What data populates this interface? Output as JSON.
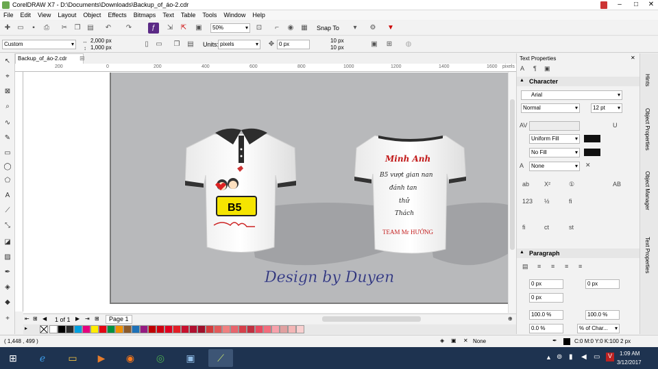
{
  "window": {
    "title": "CorelDRAW X7 - D:\\Documents\\Downloads\\Backup_of_áo-2.cdr",
    "min": "–",
    "max": "□",
    "close": "✕"
  },
  "menu": [
    "File",
    "Edit",
    "View",
    "Layout",
    "Object",
    "Effects",
    "Bitmaps",
    "Text",
    "Table",
    "Tools",
    "Window",
    "Help"
  ],
  "standard": {
    "zoom": "50%",
    "snap": "Snap To"
  },
  "property": {
    "preset": "Custom",
    "width": "2,000 px",
    "height": "1,000 px",
    "units_label": "Units:",
    "units": "pixels",
    "nudge": "0 px",
    "dup_x": "10 px",
    "dup_y": "10 px"
  },
  "document": {
    "tab": "Backup_of_áo-2.cdr",
    "ruler_ticks": [
      "200",
      "0",
      "200",
      "400",
      "600",
      "800",
      "1000",
      "1200",
      "1400",
      "1600"
    ],
    "ruler_unit": "pixels"
  },
  "design": {
    "logo_badge": "B5",
    "back_name": "Minh Anh",
    "back_line1": "B5 vượt gian nan",
    "back_line2": "đánh tan",
    "back_line3": "thử",
    "back_line4": "Thách",
    "back_team": "TEAM Mr HƯỚNG",
    "signature": "Design by Duyen"
  },
  "pager": {
    "count": "1 of 1",
    "page": "Page 1"
  },
  "palette": [
    "#ffffff",
    "#000000",
    "#2b2b2b",
    "#00a0e0",
    "#e6007e",
    "#ffed00",
    "#e30613",
    "#00923f",
    "#f39200",
    "#8b5a2b",
    "#1d71b8",
    "#951b81",
    "#c00000",
    "#d00010",
    "#e00020",
    "#e21e26",
    "#c8102e",
    "#b01030",
    "#a0102a",
    "#d43c3c",
    "#e35a5a",
    "#f08080",
    "#e8646c",
    "#d6404a",
    "#c03040",
    "#e84a5f",
    "#f26d7d",
    "#f7a1ab",
    "#e0a0a0",
    "#f4b6b6",
    "#f9d0d0"
  ],
  "docker": {
    "title": "Text Properties",
    "character": "Character",
    "font": "Arial",
    "style": "Normal",
    "size": "12 pt",
    "fill": "Uniform Fill",
    "bg_fill": "No Fill",
    "outline": "None",
    "paragraph": "Paragraph",
    "indent1": "0 px",
    "indent2": "0 px",
    "indent3": "0 px",
    "indent4": "0 px",
    "line_pct": "100.0 %",
    "char_pct": "100.0 %",
    "before": "0.0 %",
    "unit_dd": "% of Char..."
  },
  "sidetabs": [
    "Hints",
    "Object Properties",
    "Object Manager",
    "Text Properties"
  ],
  "status": {
    "coords": "( 1,448 , 499 )",
    "fill": "None",
    "color": "C:0 M:0 Y:0 K:100  2 px"
  },
  "taskbar": {
    "time": "1:09 AM",
    "date": "3/12/2017"
  }
}
